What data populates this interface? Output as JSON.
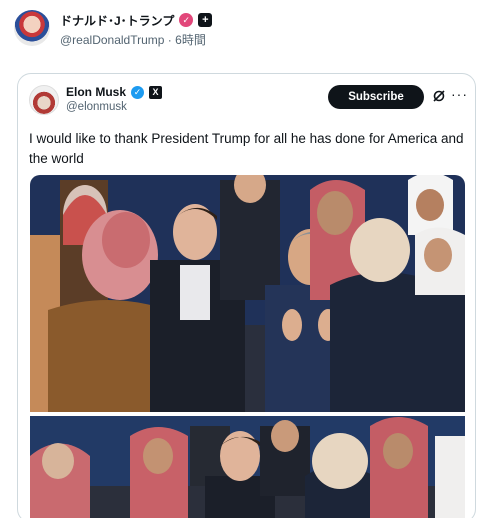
{
  "outer_post": {
    "display_name": "ドナルド･J･トランプ",
    "handle": "@realDonaldTrump",
    "separator": "·",
    "time": "6時間",
    "verified_badge_icon": "verified-pink-icon",
    "affiliate_badge_icon": "affiliate-plus-icon"
  },
  "quoted_post": {
    "display_name": "Elon Musk",
    "handle": "@elonmusk",
    "verified_badge_icon": "verified-blue-icon",
    "affiliate_badge_icon": "x-logo-icon",
    "subscribe_label": "Subscribe",
    "text": "I would like to thank President Trump for all he has done for America and the world",
    "media_count": 2
  },
  "colors": {
    "text_primary": "#0f1419",
    "text_secondary": "#536471",
    "border": "#cfd9de",
    "verified_blue": "#1d9bf0",
    "pink_badge": "#e2477a",
    "button_bg": "#0f1419"
  }
}
